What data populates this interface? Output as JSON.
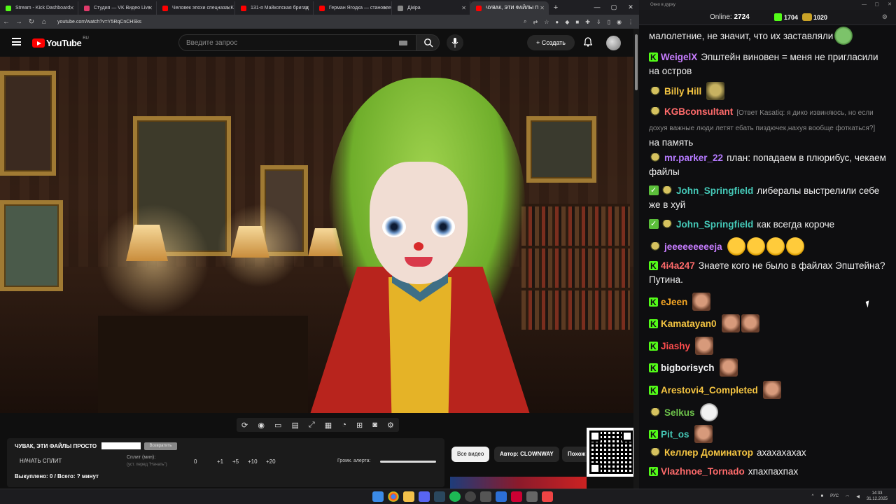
{
  "browser": {
    "tabs": [
      {
        "label": "Stream - Kick Dashboard",
        "favicon_color": "#53fc18"
      },
      {
        "label": "Студия — VK Видео Live",
        "favicon_color": "#e03a6b"
      },
      {
        "label": "Человек эпохи спецназа. K",
        "favicon_color": "#ff0000"
      },
      {
        "label": "131-я Майкопская бригад",
        "favicon_color": "#ff0000"
      },
      {
        "label": "Герман Ягодка — становле",
        "favicon_color": "#ff0000"
      },
      {
        "label": "Дiкipa",
        "favicon_color": "#888888"
      },
      {
        "label": "ЧУВАК, ЭТИ ФАЙЛЫ П",
        "favicon_color": "#ff0000"
      }
    ],
    "url": "youtube.com/watch?v=Y5RqCnCHSks"
  },
  "youtube": {
    "logo_text": "YouTube",
    "region": "RU",
    "search_placeholder": "Введите запрос",
    "create_label": "+ Создать"
  },
  "controls": {
    "icons": [
      "repeat-icon",
      "broadcast-icon",
      "cinema-icon",
      "film-icon",
      "expand-icon",
      "filmstrip-icon",
      "speed-icon",
      "add-frame-icon",
      "camera-icon",
      "settings-icon"
    ]
  },
  "split_panel": {
    "title": "ЧУВАК, ЭТИ ФАЙЛЫ ПРОСТО",
    "restore_label": "Возвратить",
    "start_label": "НАЧАТЬ СПЛИТ",
    "min_label": "Сплит (мин):",
    "min_hint": "(уст. перед \"Начать\")",
    "current_value": "0",
    "increments": [
      "+1",
      "+5",
      "+10",
      "+20"
    ],
    "alert_label": "Громк. алерта:",
    "alert_volume": 1.0,
    "bought": "Выкуплено: 0 / Всего: ? минут"
  },
  "chips": [
    "Все видео",
    "Автор: CLOWNWAY",
    "Похож"
  ],
  "chat": {
    "window_title": "Окно в дурку",
    "online_label": "Online:",
    "online_count": "2724",
    "kick_count": "1704",
    "coin_count": "1020",
    "messages": [
      {
        "badge": "none",
        "user": "",
        "color": "#efeff1",
        "text": "малолетние, не значит, что их заставляли",
        "emotes": [
          "frog"
        ]
      },
      {
        "badge": "k",
        "user": "WeigelX",
        "color": "#c77dff",
        "text": "Эпштейн виновен = меня не пригласили на остров",
        "emotes": []
      },
      {
        "badge": "p",
        "user": "Billy Hill",
        "color": "#f5c542",
        "text": "",
        "emotes": [
          "rob"
        ]
      },
      {
        "badge": "p",
        "user": "KGBconsultant",
        "color": "#ff6b6b",
        "reply": "[Ответ Kasatiq: я дико извиняюсь, но если дохуя важные люди летят ебать пиздючек,нахуя вообще фоткаться?]",
        "text": "на память",
        "emotes": []
      },
      {
        "badge": "p",
        "user": "mr.parker_22",
        "color": "#b57aff",
        "text": "план: попадаем в плюрибус, чекаем файлы",
        "emotes": []
      },
      {
        "badge": "vp",
        "user": "John_Springfield",
        "color": "#45c9b8",
        "text": "либералы выстрелили себе же в хуй",
        "emotes": []
      },
      {
        "badge": "vp",
        "user": "John_Springfield",
        "color": "#45c9b8",
        "text": "как всегда короче",
        "emotes": []
      },
      {
        "badge": "p",
        "user": "jeeeeeeeeeja",
        "color": "#c77dff",
        "text": "",
        "emotes": [
          "laugh",
          "laugh",
          "laugh",
          "laugh"
        ]
      },
      {
        "badge": "k",
        "user": "4i4a247",
        "color": "#ff6b6b",
        "text": "Знаете кого не было в файлах Эпштейна? Путина.",
        "emotes": []
      },
      {
        "badge": "k",
        "user": "eJeen",
        "color": "#f5a623",
        "text": "",
        "emotes": [
          "face"
        ]
      },
      {
        "badge": "k",
        "user": "Kamatayan0",
        "color": "#f5c542",
        "text": "",
        "emotes": [
          "face",
          "face"
        ]
      },
      {
        "badge": "k",
        "user": "Jiashy",
        "color": "#ff4d4d",
        "text": "",
        "emotes": [
          "face"
        ]
      },
      {
        "badge": "k",
        "user": "bigborisych",
        "color": "#efeff1",
        "text": "",
        "emotes": [
          "face"
        ]
      },
      {
        "badge": "k",
        "user": "Arestovi4_Completed",
        "color": "#f5c542",
        "text": "",
        "emotes": [
          "face"
        ]
      },
      {
        "badge": "p",
        "user": "Selkus",
        "color": "#6cc04a",
        "text": "",
        "emotes": [
          "troll"
        ]
      },
      {
        "badge": "k",
        "user": "Pit_os",
        "color": "#45c9b8",
        "text": "",
        "emotes": [
          "face"
        ]
      },
      {
        "badge": "p",
        "user": "Келлер Доминатор",
        "color": "#f5c542",
        "text": "ахахахахах",
        "emotes": []
      },
      {
        "badge": "k",
        "user": "Vlazhnoe_Tornado",
        "color": "#ff6b6b",
        "text": "хпахпахпах",
        "emotes": []
      }
    ]
  },
  "taskbar": {
    "lang": "РУС",
    "time": "14:33",
    "date": "31.12.2025"
  }
}
